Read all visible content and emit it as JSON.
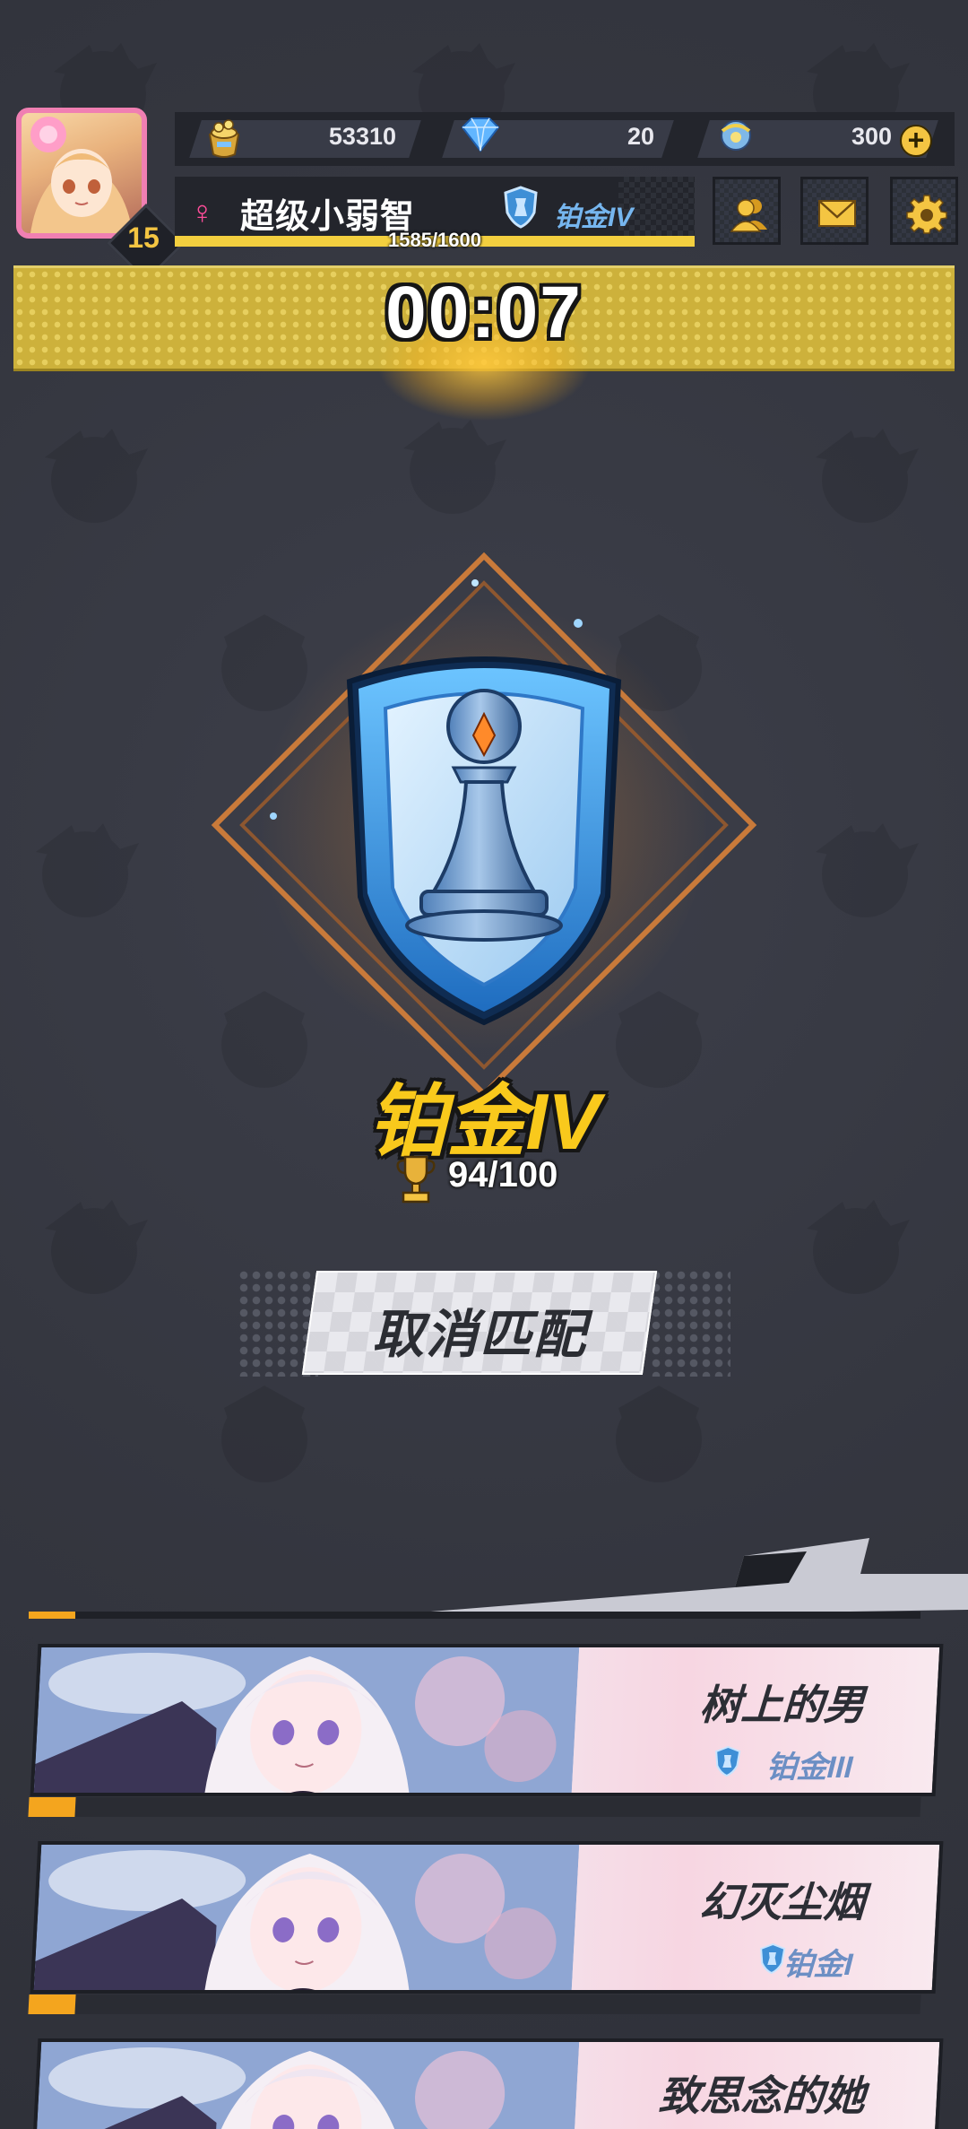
{
  "player": {
    "level": "15",
    "name": "超级小弱智",
    "gender_symbol": "♀",
    "rank": "铂金IV",
    "xp": "1585/1600",
    "xp_fraction": 0.99
  },
  "currencies": [
    {
      "icon": "gold-pot-icon",
      "value": "53310"
    },
    {
      "icon": "diamond-icon",
      "value": "20"
    },
    {
      "icon": "ticket-icon",
      "value": "300"
    }
  ],
  "menu": {
    "friends_icon": "friends-icon",
    "mail_icon": "mail-icon",
    "settings_icon": "gear-icon"
  },
  "matchmaking": {
    "timer": "00:07",
    "rank_title": "铂金IV",
    "points": "94/100",
    "cancel_label": "取消匹配"
  },
  "match_players": [
    {
      "name": "树上的男",
      "rank": "铂金III"
    },
    {
      "name": "幻灭尘烟",
      "rank": "铂金I"
    },
    {
      "name": "致思念的她",
      "rank": ""
    }
  ],
  "colors": {
    "accent_gold": "#f9c91c",
    "rank_blue": "#76b6ef",
    "banner_yellow": "#cdb13b",
    "background": "#34363f"
  }
}
